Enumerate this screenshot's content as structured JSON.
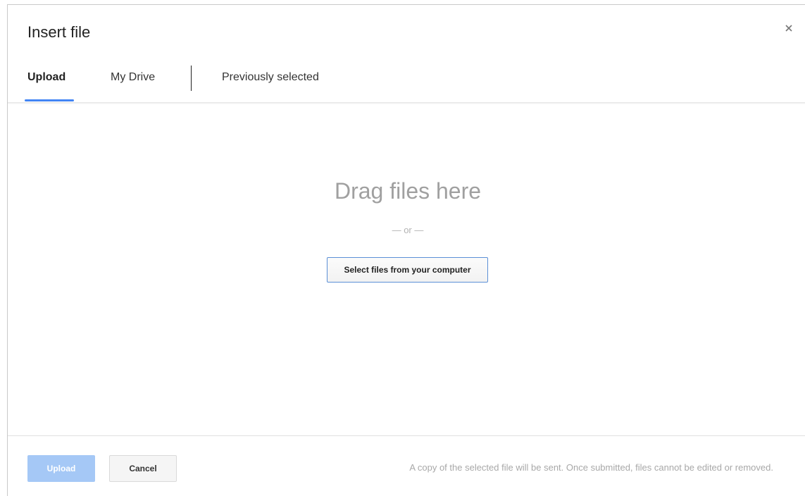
{
  "dialog": {
    "title": "Insert file",
    "close_icon": "close-icon"
  },
  "tabs": [
    {
      "label": "Upload",
      "active": true
    },
    {
      "label": "My Drive",
      "active": false
    },
    {
      "label": "Previously selected",
      "active": false
    }
  ],
  "dropzone": {
    "title": "Drag files here",
    "or_text": "— or —",
    "select_button": "Select files from your computer"
  },
  "footer": {
    "upload_label": "Upload",
    "cancel_label": "Cancel",
    "note": "A copy of the selected file will be sent. Once submitted, files cannot be edited or removed."
  },
  "colors": {
    "accent": "#4285f4",
    "upload_disabled": "#a5c8f6",
    "muted_text": "#a0a0a0"
  }
}
